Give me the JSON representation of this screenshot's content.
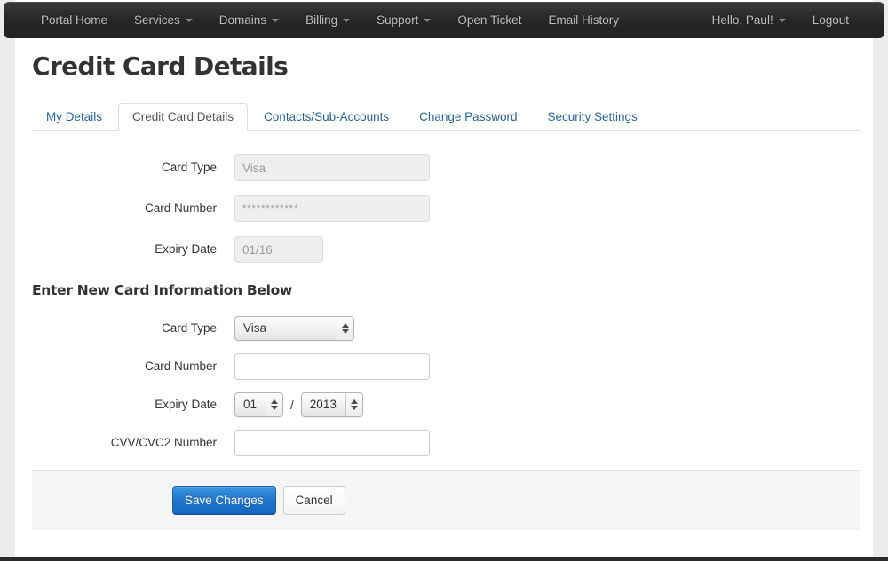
{
  "navbar": {
    "left_items": [
      {
        "label": "Portal Home",
        "caret": false
      },
      {
        "label": "Services",
        "caret": true
      },
      {
        "label": "Domains",
        "caret": true
      },
      {
        "label": "Billing",
        "caret": true
      },
      {
        "label": "Support",
        "caret": true
      },
      {
        "label": "Open Ticket",
        "caret": false
      },
      {
        "label": "Email History",
        "caret": false
      }
    ],
    "right_items": [
      {
        "label": "Hello, Paul!",
        "caret": true
      },
      {
        "label": "Logout",
        "caret": false
      }
    ]
  },
  "page": {
    "title": "Credit Card Details"
  },
  "tabs": [
    {
      "label": "My Details",
      "active": false
    },
    {
      "label": "Credit Card Details",
      "active": true
    },
    {
      "label": "Contacts/Sub-Accounts",
      "active": false
    },
    {
      "label": "Change Password",
      "active": false
    },
    {
      "label": "Security Settings",
      "active": false
    }
  ],
  "existing_card": {
    "card_type_label": "Card Type",
    "card_type_value": "Visa",
    "card_number_label": "Card Number",
    "card_number_value": "************",
    "expiry_date_label": "Expiry Date",
    "expiry_date_value": "01/16"
  },
  "new_card": {
    "heading": "Enter New Card Information Below",
    "card_type_label": "Card Type",
    "card_type_value": "Visa",
    "card_number_label": "Card Number",
    "card_number_value": "",
    "expiry_date_label": "Expiry Date",
    "expiry_month_value": "01",
    "expiry_separator": "/",
    "expiry_year_value": "2013",
    "cvv_label": "CVV/CVC2 Number",
    "cvv_value": ""
  },
  "actions": {
    "save_label": "Save Changes",
    "cancel_label": "Cancel"
  },
  "colors": {
    "navbar_bg": "#272727",
    "link_blue": "#2a6496",
    "primary_button": "#1f72ca",
    "footer_bar_bg": "#f5f5f5",
    "disabled_field_bg": "#eeeeee",
    "page_bg": "#ececec"
  }
}
